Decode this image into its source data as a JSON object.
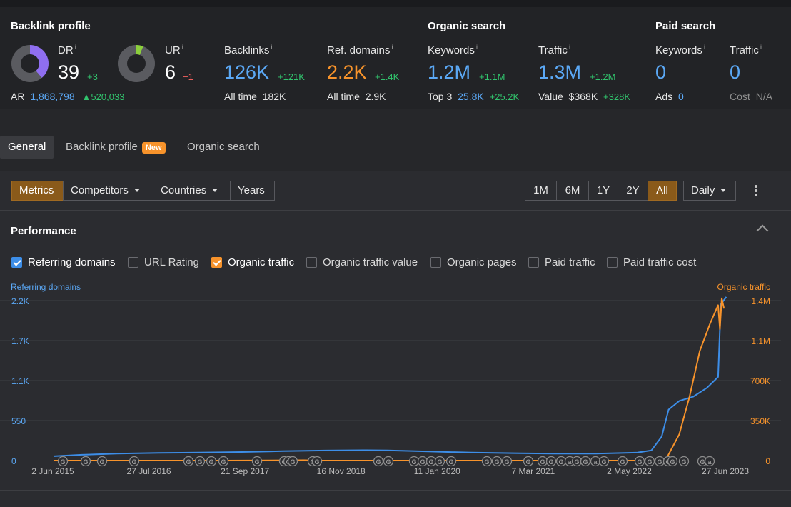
{
  "backlink_profile": {
    "title": "Backlink profile",
    "dr": {
      "label": "DR",
      "info": "i",
      "value": "39",
      "delta": "+3",
      "fill_percent": 39
    },
    "ur": {
      "label": "UR",
      "info": "i",
      "value": "6",
      "delta": "−1",
      "fill_percent": 6
    },
    "ar": {
      "label": "AR",
      "value": "1,868,798",
      "delta": "520,033"
    },
    "backlinks": {
      "label": "Backlinks",
      "info": "i",
      "value": "126K",
      "delta": "+121K",
      "sub_label": "All time",
      "sub_value": "182K"
    },
    "ref_domains": {
      "label": "Ref. domains",
      "info": "i",
      "value": "2.2K",
      "delta": "+1.4K",
      "sub_label": "All time",
      "sub_value": "2.9K"
    }
  },
  "organic_search": {
    "title": "Organic search",
    "keywords": {
      "label": "Keywords",
      "info": "i",
      "value": "1.2M",
      "delta": "+1.1M",
      "sub_label": "Top 3",
      "sub_value": "25.8K",
      "sub_delta": "+25.2K"
    },
    "traffic": {
      "label": "Traffic",
      "info": "i",
      "value": "1.3M",
      "delta": "+1.2M",
      "sub_label": "Value",
      "sub_value": "$368K",
      "sub_delta": "+328K"
    }
  },
  "paid_search": {
    "title": "Paid search",
    "keywords": {
      "label": "Keywords",
      "info": "i",
      "value": "0",
      "sub_label": "Ads",
      "sub_value": "0"
    },
    "traffic": {
      "label": "Traffic",
      "info": "i",
      "value": "0",
      "sub_label": "Cost",
      "sub_value": "N/A"
    }
  },
  "tabs": [
    {
      "label": "General",
      "active": true
    },
    {
      "label": "Backlink profile",
      "badge": "New"
    },
    {
      "label": "Organic search"
    }
  ],
  "toolbar": {
    "left": [
      "Metrics",
      "Competitors",
      "Countries",
      "Years"
    ],
    "ranges": [
      "1M",
      "6M",
      "1Y",
      "2Y",
      "All"
    ],
    "active_range": "All",
    "granularity": "Daily"
  },
  "performance": {
    "title": "Performance",
    "checkboxes": [
      {
        "label": "Referring domains",
        "checked": true,
        "color": "#3d8ee8"
      },
      {
        "label": "URL Rating",
        "checked": false
      },
      {
        "label": "Organic traffic",
        "checked": true,
        "color": "#f7932b"
      },
      {
        "label": "Organic traffic value",
        "checked": false
      },
      {
        "label": "Organic pages",
        "checked": false
      },
      {
        "label": "Paid traffic",
        "checked": false
      },
      {
        "label": "Paid traffic cost",
        "checked": false
      }
    ]
  },
  "chart_data": {
    "type": "line",
    "left_axis_title": "Referring domains",
    "right_axis_title": "Organic traffic",
    "left_ticks": [
      "0",
      "550",
      "1.1K",
      "1.7K",
      "2.2K"
    ],
    "right_ticks": [
      "0",
      "350K",
      "700K",
      "1.1M",
      "1.4M"
    ],
    "x_ticks": [
      "2 Jun 2015",
      "27 Jul 2016",
      "21 Sep 2017",
      "16 Nov 2018",
      "11 Jan 2020",
      "7 Mar 2021",
      "2 May 2022",
      "27 Jun 2023"
    ],
    "grid": true,
    "ylim_left": [
      0,
      2200
    ],
    "ylim_right": [
      0,
      1400000
    ],
    "series": [
      {
        "name": "Referring domains",
        "color": "#3d8ee8",
        "axis": "left",
        "points": [
          [
            "2015-06-02",
            60
          ],
          [
            "2015-10-01",
            80
          ],
          [
            "2016-03-01",
            95
          ],
          [
            "2016-09-01",
            105
          ],
          [
            "2017-03-01",
            110
          ],
          [
            "2017-09-01",
            118
          ],
          [
            "2018-03-01",
            130
          ],
          [
            "2018-09-01",
            138
          ],
          [
            "2019-03-01",
            142
          ],
          [
            "2019-06-01",
            140
          ],
          [
            "2019-12-01",
            125
          ],
          [
            "2020-06-01",
            110
          ],
          [
            "2021-01-01",
            100
          ],
          [
            "2021-06-01",
            95
          ],
          [
            "2021-12-01",
            95
          ],
          [
            "2022-06-01",
            110
          ],
          [
            "2022-08-01",
            140
          ],
          [
            "2022-09-15",
            330
          ],
          [
            "2022-10-15",
            700
          ],
          [
            "2022-12-01",
            820
          ],
          [
            "2023-02-01",
            880
          ],
          [
            "2023-04-01",
            1000
          ],
          [
            "2023-05-20",
            1150
          ],
          [
            "2023-06-01",
            2150
          ],
          [
            "2023-06-25",
            2250
          ]
        ]
      },
      {
        "name": "Organic traffic",
        "color": "#f7932b",
        "axis": "right",
        "points": [
          [
            "2015-06-02",
            0
          ],
          [
            "2016-06-01",
            0
          ],
          [
            "2017-06-01",
            0
          ],
          [
            "2018-06-01",
            3000
          ],
          [
            "2018-08-01",
            0
          ],
          [
            "2019-06-01",
            0
          ],
          [
            "2020-06-01",
            0
          ],
          [
            "2021-06-01",
            0
          ],
          [
            "2022-06-01",
            0
          ],
          [
            "2022-10-01",
            0
          ],
          [
            "2022-12-01",
            230000
          ],
          [
            "2023-01-15",
            560000
          ],
          [
            "2023-03-01",
            960000
          ],
          [
            "2023-04-15",
            1200000
          ],
          [
            "2023-05-20",
            1360000
          ],
          [
            "2023-05-28",
            1150000
          ],
          [
            "2023-06-05",
            1420000
          ],
          [
            "2023-06-15",
            1330000
          ]
        ]
      }
    ],
    "annotation_markers": [
      "G",
      "G",
      "G",
      "G",
      "G",
      "G",
      "G",
      "G",
      "G",
      "G",
      "G",
      "G",
      "G",
      "G",
      "G",
      "G",
      "G",
      "G",
      "G",
      "G",
      "G",
      "G",
      "G",
      "G",
      "G",
      "G",
      "G",
      "G",
      "a",
      "G",
      "G",
      "a",
      "G",
      "G",
      "G",
      "G",
      "G",
      "G",
      "G",
      "G",
      "G",
      "a"
    ]
  }
}
